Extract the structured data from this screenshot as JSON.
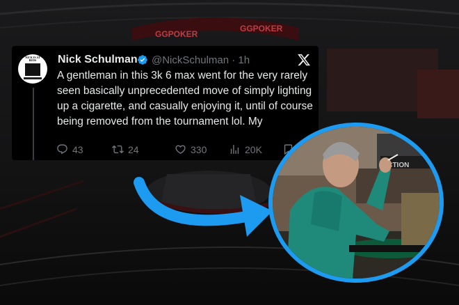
{
  "tweet": {
    "display_name": "Nick Schulman",
    "handle_time": "@NickSchulman · 1h",
    "text": "A gentleman in this 3k 6 max went for the very rarely seen basically unprecedented move of simply lighting up a cigarette, and casually enjoying it, until of course being removed from the tournament lol. My",
    "replies": "43",
    "reposts": "24",
    "likes": "330",
    "views": "20K",
    "avatar_lettering": "NICK IS AT BEDS"
  },
  "background_signage": {
    "sponsor_1": "GGPOKER",
    "sponsor_2": "GGPOKER",
    "photo_sign": "ACTION"
  },
  "icons": {
    "verified": "verified-badge-icon",
    "platform": "x-logo-icon",
    "reply": "reply-icon",
    "repost": "repost-icon",
    "like": "heart-icon",
    "views": "views-icon",
    "bookmark": "bookmark-icon"
  },
  "colors": {
    "accent_blue": "#1d9bf0",
    "tweet_bg": "#000000",
    "text_primary": "#e7e9ea",
    "text_secondary": "#71767b"
  }
}
